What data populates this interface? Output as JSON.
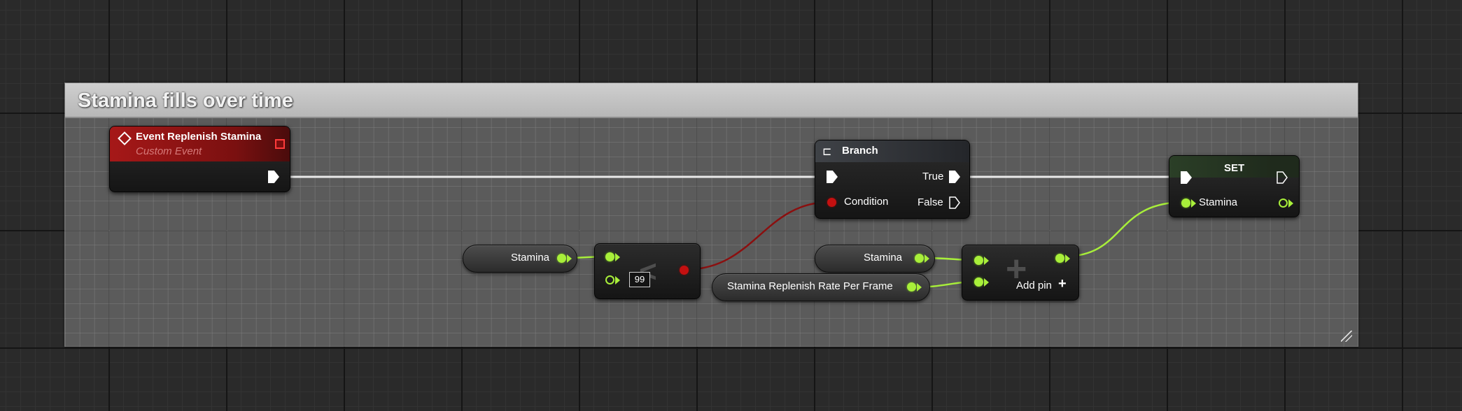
{
  "comment": {
    "title": "Stamina fills over time"
  },
  "event_node": {
    "title": "Event Replenish Stamina",
    "subtitle": "Custom Event"
  },
  "branch_node": {
    "title": "Branch",
    "true_label": "True",
    "false_label": "False",
    "condition_label": "Condition"
  },
  "set_node": {
    "title": "SET",
    "input_label": "Stamina"
  },
  "stamina_get_1": {
    "label": "Stamina"
  },
  "stamina_get_2": {
    "label": "Stamina"
  },
  "replenish_rate_get": {
    "label": "Stamina Replenish Rate Per Frame"
  },
  "compare_node": {
    "literal_value": "99",
    "symbol": "<"
  },
  "add_node": {
    "symbol": "+",
    "add_pin_label": "Add pin",
    "add_pin_icon": "+"
  },
  "colors": {
    "exec_wire": "#ffffff",
    "float_wire": "#a8ef3a",
    "bool_wire": "#8b0f0f",
    "event_header": "#a61818"
  }
}
